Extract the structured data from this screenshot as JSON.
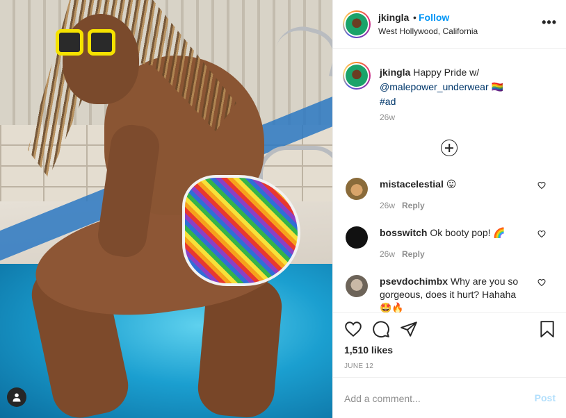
{
  "post": {
    "author": {
      "username": "jkingla",
      "follow_label": "Follow",
      "separator": "•",
      "location": "West Hollywood, California",
      "more_label": "•••"
    },
    "caption": {
      "username": "jkingla",
      "text": " Happy Pride w/ ",
      "mention": "@malepower_underwear",
      "flag": " 🏳️‍🌈",
      "hashtag": "#ad",
      "time": "26w"
    },
    "comments": [
      {
        "username": "mistacelestial",
        "text": " 😛",
        "time": "26w",
        "reply_label": "Reply"
      },
      {
        "username": "bosswitch",
        "text": " Ok booty pop! 🌈",
        "time": "26w",
        "reply_label": "Reply"
      },
      {
        "username": "psevdochimbx",
        "text": " Why are you so gorgeous, does it hurt? Hahaha 🤩🔥"
      }
    ],
    "likes_text": "1,510 likes",
    "date_text": "JUNE 12",
    "add_comment": {
      "placeholder": "Add a comment...",
      "post_label": "Post"
    }
  },
  "colors": {
    "link_blue": "#0095f6",
    "mention_blue": "#00376b",
    "muted_gray": "#8e8e8e",
    "post_disabled": "#b2dffc",
    "text_primary": "#262626"
  },
  "icons": {
    "like": "heart-icon",
    "comment": "comment-icon",
    "share": "share-icon",
    "save": "bookmark-icon",
    "user_tag": "user-tag-icon",
    "load_more": "plus-circle-icon"
  }
}
